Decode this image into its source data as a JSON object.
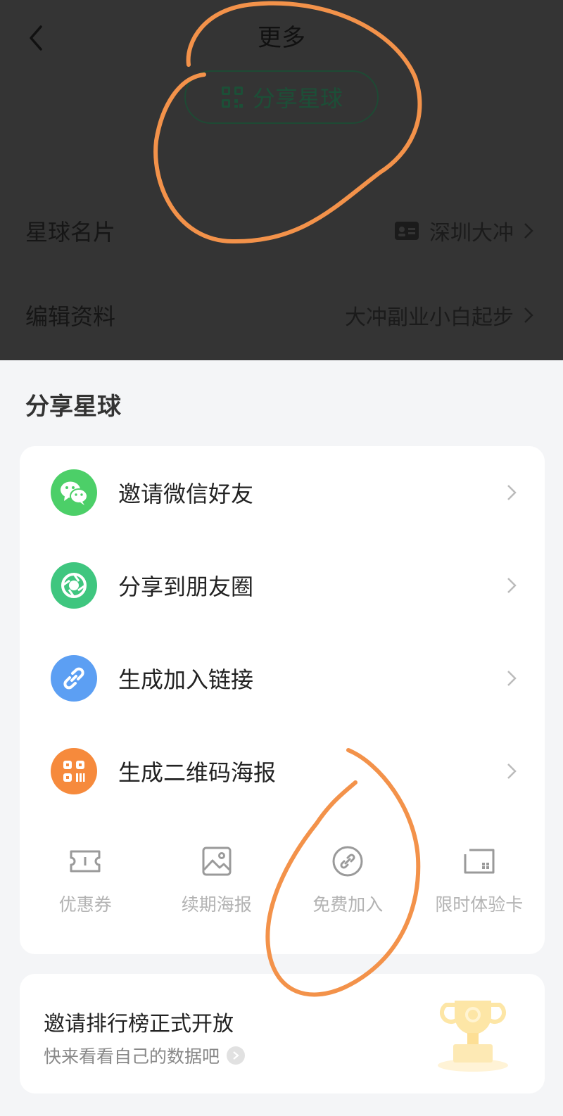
{
  "header": {
    "title": "更多",
    "share_button_label": "分享星球"
  },
  "profile_rows": [
    {
      "label": "星球名片",
      "value": "深圳大冲"
    },
    {
      "label": "编辑资料",
      "value": "大冲副业小白起步"
    }
  ],
  "sheet": {
    "title": "分享星球",
    "actions": [
      {
        "label": "邀请微信好友",
        "icon": "wechat-icon",
        "color": "#4ccf68"
      },
      {
        "label": "分享到朋友圈",
        "icon": "moments-icon",
        "color": "#3fc67f"
      },
      {
        "label": "生成加入链接",
        "icon": "link-icon",
        "color": "#5c9ff3"
      },
      {
        "label": "生成二维码海报",
        "icon": "qrcode-icon",
        "color": "#f68a3c"
      }
    ],
    "tools": [
      {
        "label": "优惠券",
        "icon": "coupon-icon"
      },
      {
        "label": "续期海报",
        "icon": "image-icon"
      },
      {
        "label": "免费加入",
        "icon": "link-circle-icon"
      },
      {
        "label": "限时体验卡",
        "icon": "card-icon"
      }
    ]
  },
  "ranking": {
    "title": "邀请排行榜正式开放",
    "subtitle": "快来看看自己的数据吧"
  }
}
